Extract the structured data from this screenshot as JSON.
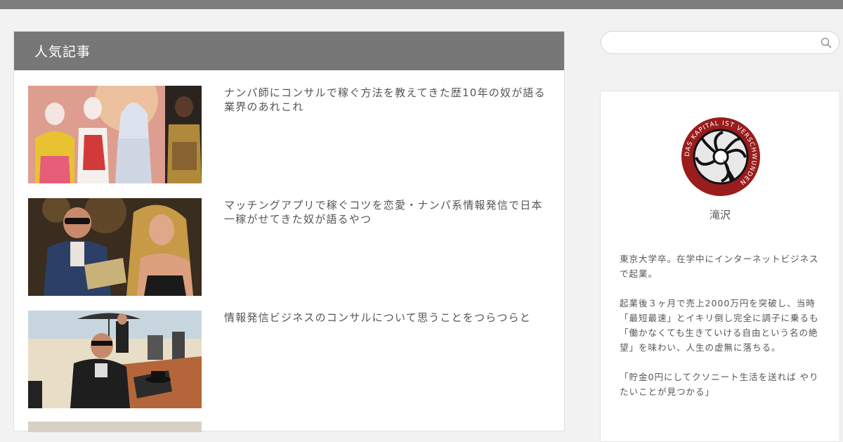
{
  "popular": {
    "heading": "人気記事",
    "posts": [
      {
        "title": "ナンパ師にコンサルで稼ぐ方法を教えてきた歴10年の奴が語る業界のあれこれ"
      },
      {
        "title": "マッチングアプリで稼ぐコツを恋愛・ナンパ系情報発信で日本一稼がせてきた奴が語るやつ"
      },
      {
        "title": "情報発信ビジネスのコンサルについて思うことをつらつらと"
      }
    ]
  },
  "search": {
    "placeholder": "",
    "icon": "search-icon"
  },
  "profile": {
    "logo_text": "DAS KAPITAL IST VERSCHWUNDEN",
    "name": "滝沢",
    "bio": [
      "東京大学卒。在学中にインターネットビジネスで起業。",
      "起業後３ヶ月で売上2000万円を突破し、当時「最短最速」とイキリ倒し完全に調子に乗るも「働かなくても生きていける自由という名の絶望」を味わい、人生の虚無に落ちる。",
      "「貯金0円にしてクソニート生活を送れば やりたいことが見つかる」"
    ]
  },
  "colors": {
    "header_bg": "#777777",
    "topbar": "#7d7d7d",
    "page_bg": "#f2f2f2"
  }
}
